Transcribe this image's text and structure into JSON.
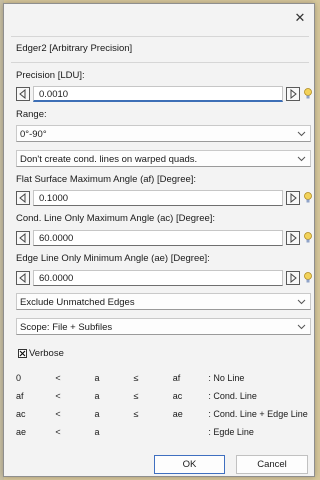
{
  "dialog": {
    "title": "Edger2 [Arbitrary Precision]",
    "close_glyph": "✕"
  },
  "precision": {
    "label": "Precision [LDU]:",
    "value": "0.0010"
  },
  "range": {
    "label": "Range:",
    "value": "0°-90°",
    "warped_option": "Don't create cond. lines on warped quads."
  },
  "af": {
    "label": "Flat Surface Maximum Angle (af) [Degree]:",
    "value": "0.1000"
  },
  "ac": {
    "label": "Cond. Line Only Maximum Angle (ac) [Degree]:",
    "value": "60.0000"
  },
  "ae": {
    "label": "Edge Line Only Minimum Angle (ae) [Degree]:",
    "value": "60.0000"
  },
  "edges_option": "Exclude Unmatched Edges",
  "scope_option": "Scope: File + Subfiles",
  "verbose": {
    "label": "Verbose",
    "checked": true
  },
  "legend": [
    [
      "0",
      "<",
      "a",
      "≤",
      "af",
      ": No Line"
    ],
    [
      "af",
      "<",
      "a",
      "≤",
      "ac",
      ": Cond. Line"
    ],
    [
      "ac",
      "<",
      "a",
      "≤",
      "ae",
      ": Cond. Line + Edge Line"
    ],
    [
      "ae",
      "<",
      "a",
      "",
      "",
      ": Egde Line"
    ]
  ],
  "buttons": {
    "ok": "OK",
    "cancel": "Cancel"
  },
  "icons": {
    "decrement": "left-arrow-icon",
    "increment": "right-arrow-icon",
    "hint": "lightbulb-icon",
    "dropdown": "chevron-down-icon"
  }
}
